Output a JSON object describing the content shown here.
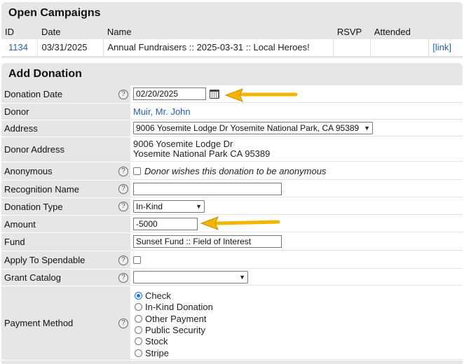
{
  "campaigns": {
    "title": "Open Campaigns",
    "columns": [
      "ID",
      "Date",
      "Name",
      "RSVP",
      "Attended",
      ""
    ],
    "rows": [
      {
        "id": "1134",
        "date": "03/31/2025",
        "name": "Annual Fundraisers :: 2025-03-31 :: Local Heroes!",
        "rsvp": "",
        "attended": "",
        "link": "[link]"
      }
    ]
  },
  "donation": {
    "title": "Add Donation",
    "fields": {
      "donation_date": {
        "label": "Donation Date",
        "value": "02/20/2025"
      },
      "donor": {
        "label": "Donor",
        "value": "Muir, Mr. John"
      },
      "address": {
        "label": "Address",
        "value": "9006 Yosemite Lodge Dr Yosemite National Park, CA 95389"
      },
      "donor_address": {
        "label": "Donor Address",
        "line1": "9006 Yosemite Lodge Dr",
        "line2": "Yosemite National Park CA 95389"
      },
      "anonymous": {
        "label": "Anonymous",
        "checkbox_label": "Donor wishes this donation to be anonymous"
      },
      "recognition_name": {
        "label": "Recognition Name",
        "value": ""
      },
      "donation_type": {
        "label": "Donation Type",
        "value": "In-Kind"
      },
      "amount": {
        "label": "Amount",
        "value": "-5000"
      },
      "fund": {
        "label": "Fund",
        "value": "Sunset Fund :: Field of Interest"
      },
      "apply_to_spendable": {
        "label": "Apply To Spendable"
      },
      "grant_catalog": {
        "label": "Grant Catalog",
        "value": ""
      },
      "payment_method": {
        "label": "Payment Method",
        "options": [
          "Check",
          "In-Kind Donation",
          "Other Payment",
          "Public Security",
          "Stock",
          "Stripe"
        ],
        "selected": "Check"
      }
    },
    "help_glyph": "?"
  },
  "accent_colors": {
    "arrow": "#f4b400",
    "link": "#2a5db0",
    "radio": "#1a73e8"
  }
}
